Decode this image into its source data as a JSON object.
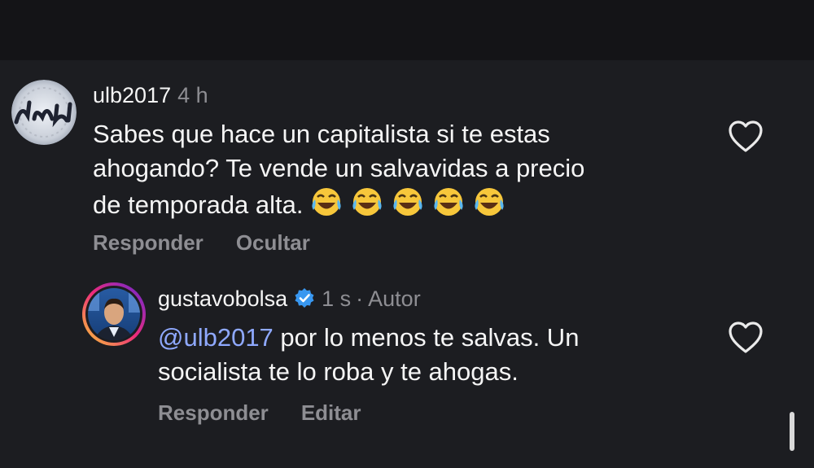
{
  "comments": [
    {
      "username": "ulb2017",
      "time": "4 h",
      "text": "Sabes que hace un capitalista si te estas ahogando? Te vende un salvavidas a precio de temporada alta.",
      "text_line1": "Sabes que hace un capitalista si te estas",
      "text_line2": "ahogando? Te vende un salvavidas a precio",
      "text_line3": "de temporada alta.",
      "emoji": "😂😂😂😂😂",
      "actions": {
        "reply": "Responder",
        "secondary": "Ocultar"
      },
      "like_icon": "heart-outline-icon"
    },
    {
      "username": "gustavobolsa",
      "verified": true,
      "time": "1 s",
      "separator": "·",
      "author_label": "Autor",
      "mention": "@ulb2017",
      "text_line1_rest": " por lo menos te salvas. Un",
      "text_line2": "socialista te lo roba y te ahogas.",
      "actions": {
        "reply": "Responder",
        "secondary": "Editar"
      },
      "like_icon": "heart-outline-icon"
    }
  ],
  "colors": {
    "background": "#1c1d21",
    "mention": "#8fa9ff",
    "muted": "#8e8e93",
    "verified": "#3897f0",
    "story_ring_start": "#f9ce34",
    "story_ring_mid": "#ee2a7b",
    "story_ring_end": "#6228d7"
  }
}
